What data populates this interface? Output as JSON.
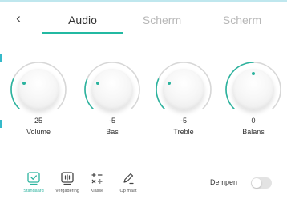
{
  "header": {
    "back_icon": "chevron-left-icon",
    "tabs": [
      {
        "label": "Audio",
        "active": true
      },
      {
        "label": "Scherm",
        "active": false
      },
      {
        "label": "Scherm",
        "active": false
      }
    ]
  },
  "knobs": [
    {
      "label": "Volume",
      "value": "25",
      "level": 25,
      "min": 0,
      "max": 100
    },
    {
      "label": "Bas",
      "value": "-5",
      "level": -5,
      "min": -10,
      "max": 10
    },
    {
      "label": "Treble",
      "value": "-5",
      "level": -5,
      "min": -10,
      "max": 10
    },
    {
      "label": "Balans",
      "value": "0",
      "level": 0,
      "min": -50,
      "max": 50
    }
  ],
  "modes": [
    {
      "label": "Standaard",
      "icon": "check-screen-icon",
      "selected": true
    },
    {
      "label": "Vergadering",
      "icon": "meeting-icon",
      "selected": false
    },
    {
      "label": "Klasse",
      "icon": "math-operators-icon",
      "selected": false
    },
    {
      "label": "Op maat",
      "icon": "pen-icon",
      "selected": false
    }
  ],
  "mute": {
    "label": "Dempen",
    "on": false
  },
  "colors": {
    "accent": "#2bb39e",
    "track": "#d7d7d7",
    "inactive_tab": "#b7b7b7"
  }
}
